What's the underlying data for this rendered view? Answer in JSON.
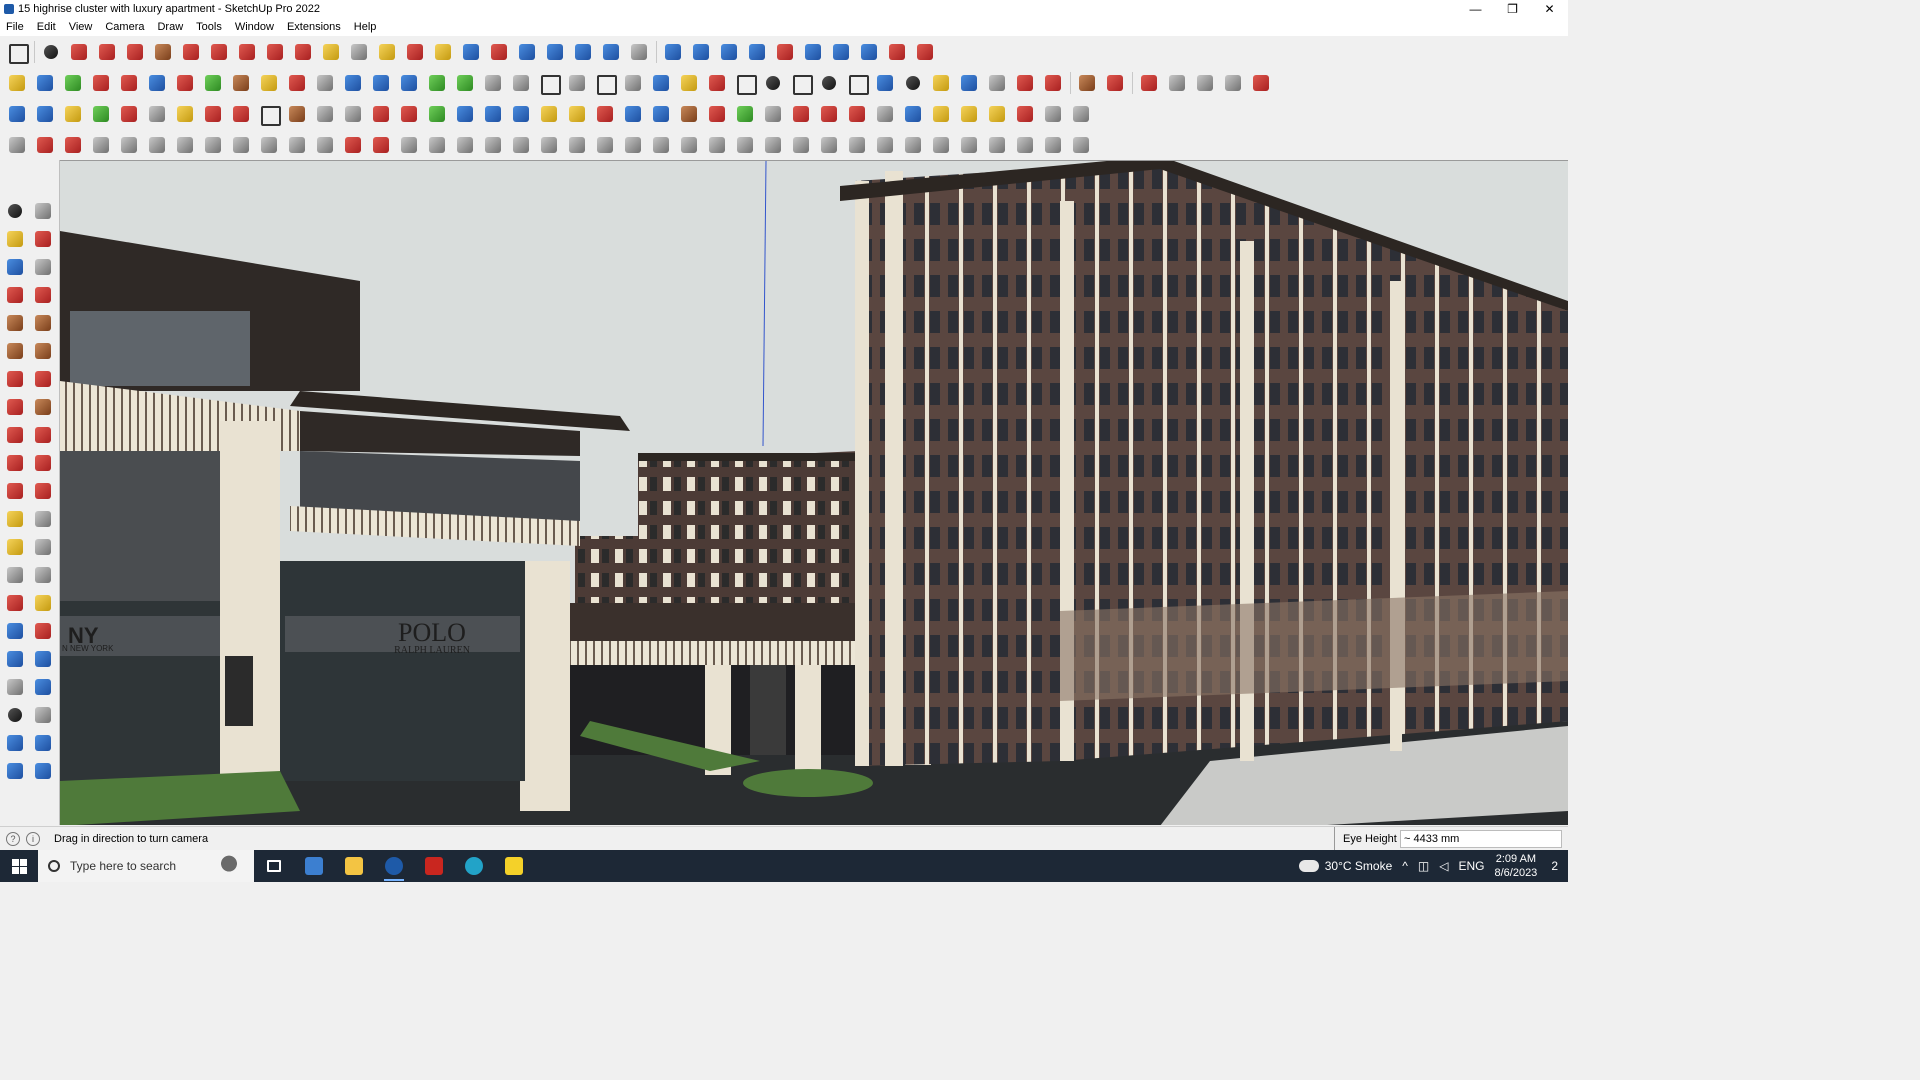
{
  "window": {
    "title": "15 highrise cluster with luxury apartment - SketchUp Pro 2022",
    "controls": [
      "—",
      "❐",
      "✕"
    ]
  },
  "menu": [
    "File",
    "Edit",
    "View",
    "Camera",
    "Draw",
    "Tools",
    "Window",
    "Extensions",
    "Help"
  ],
  "viewport": {
    "signs": {
      "polo_main": "POLO",
      "polo_sub": "RALPH LAUREN",
      "dkny_main": "NY",
      "dkny_sub": "N NEW YORK"
    }
  },
  "status": {
    "hint": "Drag in direction to turn camera",
    "vcb_label": "Eye Height",
    "vcb_value": "~ 4433 mm"
  },
  "taskbar": {
    "search_placeholder": "Type here to search",
    "weather": "30°C  Smoke",
    "language": "ENG",
    "time": "2:09 AM",
    "date": "8/6/2023",
    "notifications": "2"
  },
  "colors": {
    "sky": "#d9dddc",
    "facade_dark": "#5a4640",
    "facade_light": "#e9e2d2",
    "ground": "#2a2d2f",
    "grass": "#4f7a3a"
  }
}
